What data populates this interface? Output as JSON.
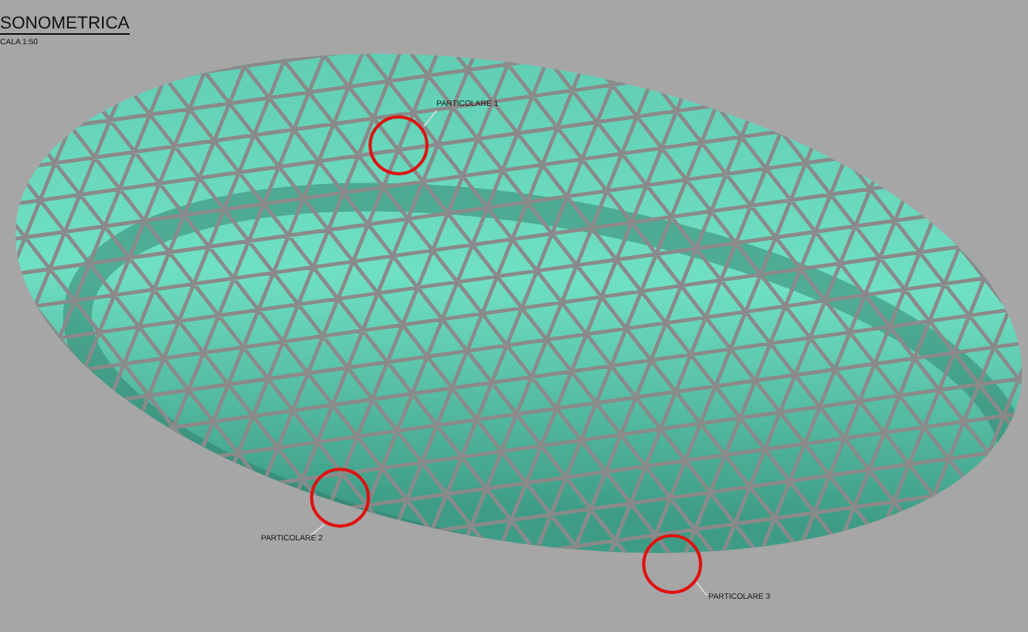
{
  "title": "SONOMETRICA",
  "scale": "CALA 1:50",
  "details": [
    {
      "label": "PARTICOLARE 1"
    },
    {
      "label": "PARTICOLARE 2"
    },
    {
      "label": "PARTICOLARE 3"
    }
  ]
}
